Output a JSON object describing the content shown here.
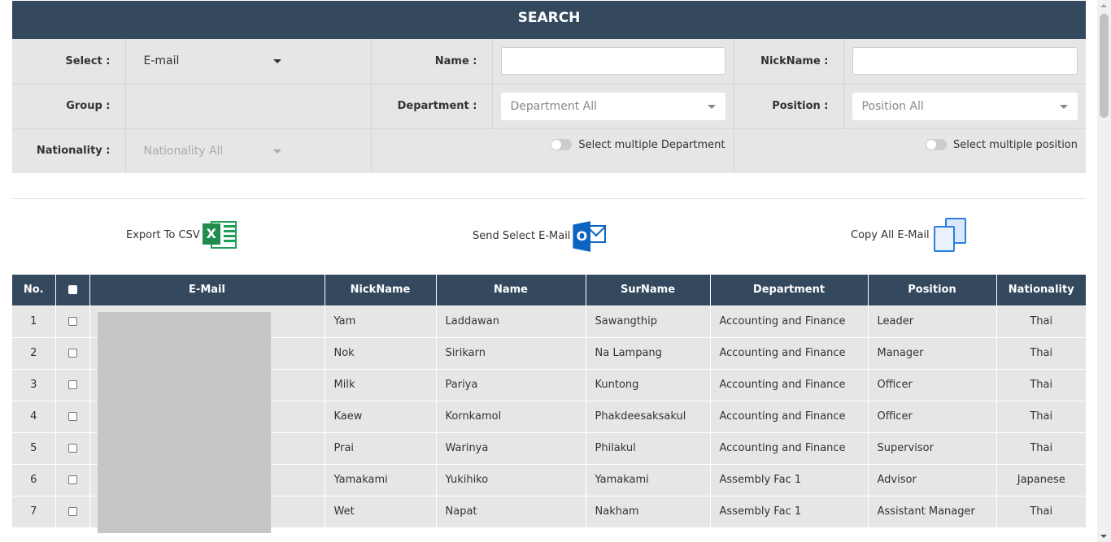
{
  "search": {
    "title": "SEARCH",
    "select_label": "Select :",
    "select_value": "E-mail",
    "name_label": "Name :",
    "name_value": "",
    "nickname_label": "NickName :",
    "nickname_value": "",
    "group_label": "Group :",
    "department_label": "Department :",
    "department_placeholder": "Department All",
    "position_label": "Position :",
    "position_placeholder": "Position All",
    "nationality_label": "Nationality :",
    "nationality_placeholder": "Nationality All",
    "multi_department_label": "Select multiple Department",
    "multi_position_label": "Select multiple position"
  },
  "actions": {
    "export_csv": "Export To CSV",
    "send_email": "Send Select E-Mail",
    "copy_email": "Copy All E-Mail"
  },
  "table": {
    "headers": [
      "No.",
      "",
      "E-Mail",
      "NickName",
      "Name",
      "SurName",
      "Department",
      "Position",
      "Nationality"
    ],
    "rows": [
      {
        "no": "1",
        "nick": "Yam",
        "name": "Laddawan",
        "surname": "Sawangthip",
        "dept": "Accounting and Finance",
        "pos": "Leader",
        "nat": "Thai"
      },
      {
        "no": "2",
        "nick": "Nok",
        "name": "Sirikarn",
        "surname": "Na Lampang",
        "dept": "Accounting and Finance",
        "pos": "Manager",
        "nat": "Thai"
      },
      {
        "no": "3",
        "nick": "Milk",
        "name": "Pariya",
        "surname": "Kuntong",
        "dept": "Accounting and Finance",
        "pos": "Officer",
        "nat": "Thai"
      },
      {
        "no": "4",
        "nick": "Kaew",
        "name": "Kornkamol",
        "surname": "Phakdeesaksakul",
        "dept": "Accounting and Finance",
        "pos": "Officer",
        "nat": "Thai"
      },
      {
        "no": "5",
        "nick": "Prai",
        "name": "Warinya",
        "surname": "Philakul",
        "dept": "Accounting and Finance",
        "pos": "Supervisor",
        "nat": "Thai"
      },
      {
        "no": "6",
        "nick": "Yamakami",
        "name": "Yukihiko",
        "surname": "Yamakami",
        "dept": "Assembly Fac 1",
        "pos": "Advisor",
        "nat": "Japanese"
      },
      {
        "no": "7",
        "nick": "Wet",
        "name": "Napat",
        "surname": "Nakham",
        "dept": "Assembly Fac 1",
        "pos": "Assistant Manager",
        "nat": "Thai"
      }
    ]
  }
}
